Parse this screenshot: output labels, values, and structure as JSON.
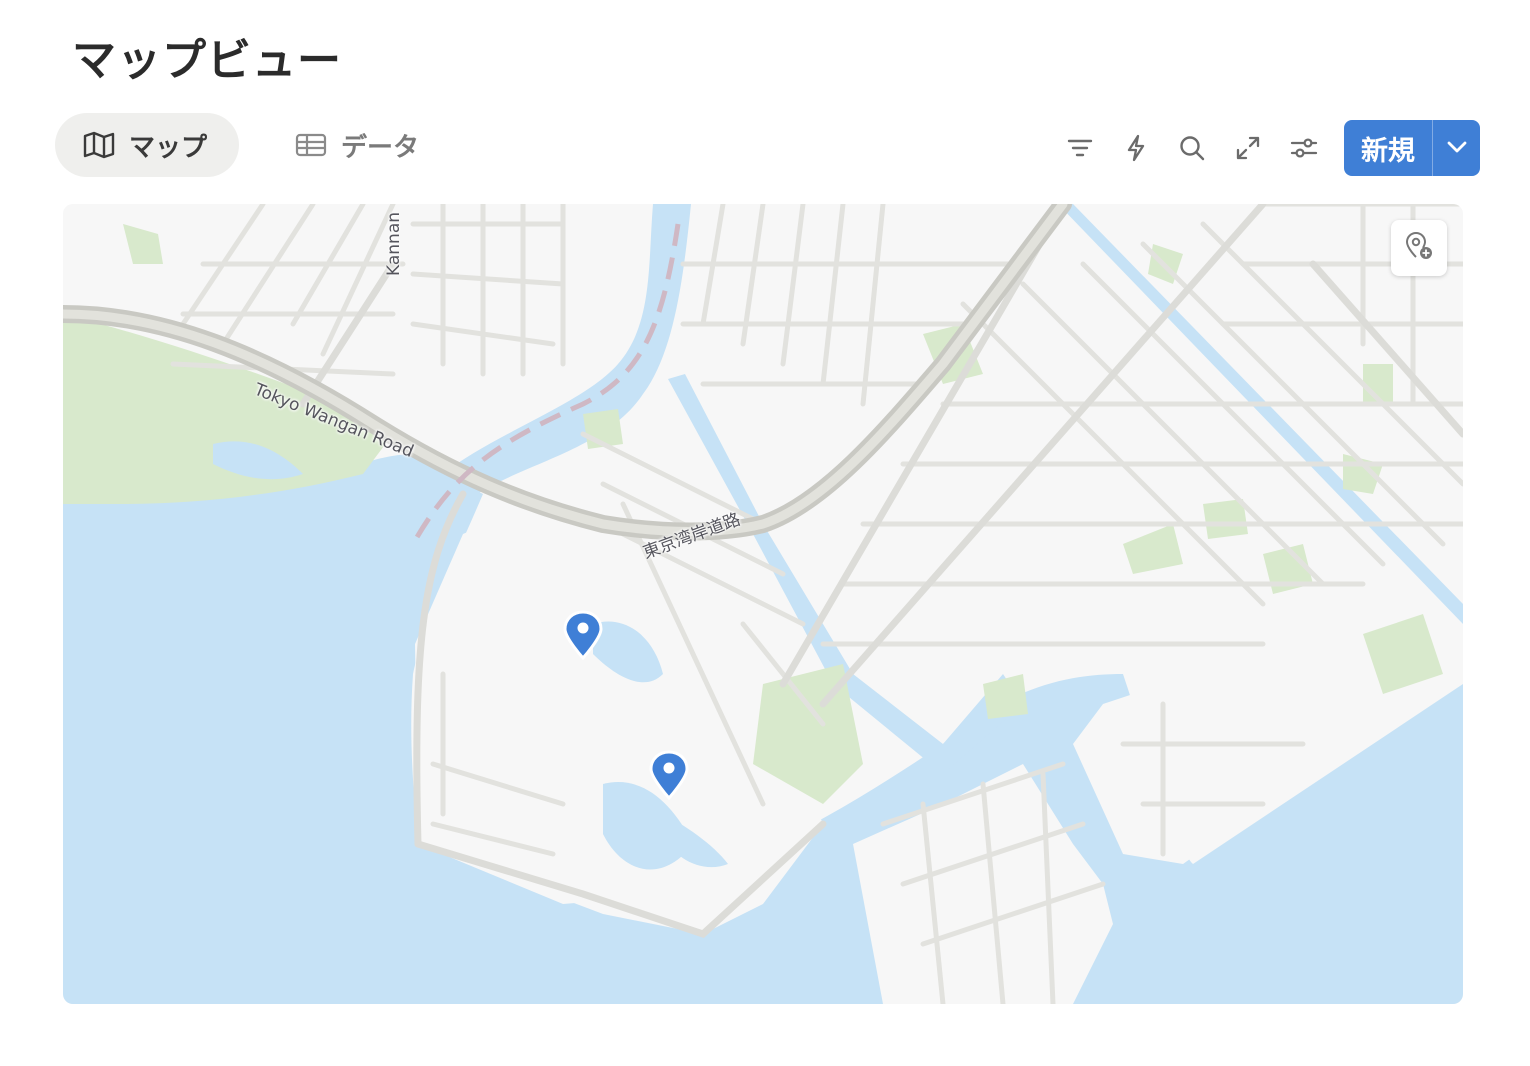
{
  "header": {
    "title": "マップビュー"
  },
  "tabs": [
    {
      "label": "マップ",
      "icon": "map-icon",
      "active": true
    },
    {
      "label": "データ",
      "icon": "table-icon",
      "active": false
    }
  ],
  "tools": {
    "icons": [
      "filter-icon",
      "lightning-icon",
      "search-icon",
      "expand-icon",
      "settings-sliders-icon"
    ],
    "new_label": "新規",
    "new_dropdown_icon": "chevron-down-icon"
  },
  "map": {
    "road_labels": {
      "kannan": "Kannan",
      "wangan_en": "Tokyo Wangan Road",
      "wangan_jp": "東京湾岸道路"
    },
    "pin_count": 2,
    "add_pin_icon": "add-location-icon"
  },
  "colors": {
    "accent": "#3f7fd6",
    "water": "#c6e2f6",
    "park": "#d8e9cc",
    "land": "#f7f7f7",
    "road": "#e2e2de"
  }
}
